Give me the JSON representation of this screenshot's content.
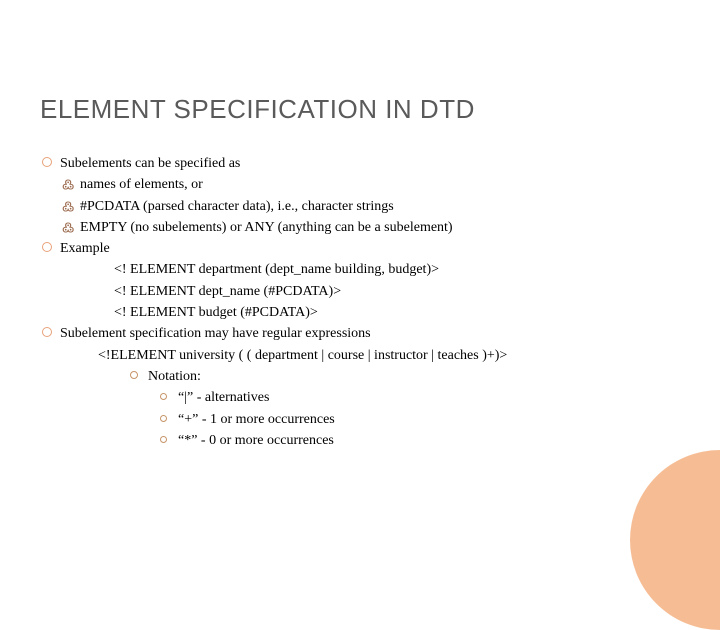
{
  "title": "ELEMENT SPECIFICATION IN DTD",
  "b1": "Subelements can be specified as",
  "b1a": "names of elements, or",
  "b1b": "#PCDATA (parsed character data), i.e., character strings",
  "b1c": "EMPTY (no subelements) or ANY (anything can be a subelement)",
  "b2": "Example",
  "code1": "<! ELEMENT department (dept_name  building, budget)>",
  "code2": "<! ELEMENT dept_name (#PCDATA)>",
  "code3": "<! ELEMENT budget (#PCDATA)>",
  "b3": "Subelement specification may have regular expressions",
  "code4": "<!ELEMENT university ( ( department | course | instructor | teaches )+)>",
  "b3a": "Notation:",
  "n1": "“|”   -  alternatives",
  "n2": "“+”  -  1 or more occurrences",
  "n3": "“*”  -  0 or more occurrences"
}
